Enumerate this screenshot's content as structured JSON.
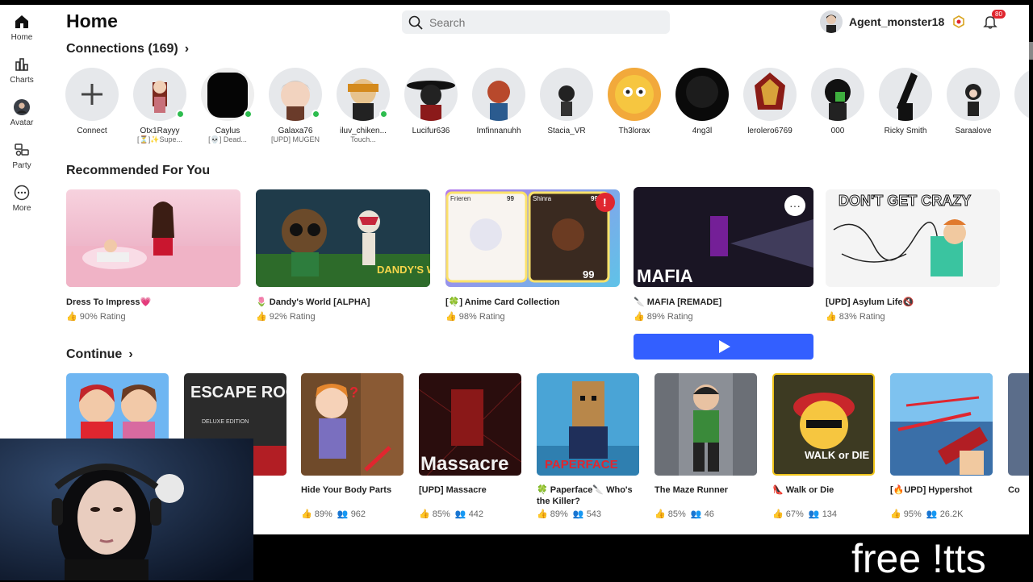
{
  "sidebar": {
    "items": [
      {
        "label": "Home",
        "icon": "home-icon"
      },
      {
        "label": "Charts",
        "icon": "charts-icon"
      },
      {
        "label": "Avatar",
        "icon": "avatar-icon"
      },
      {
        "label": "Party",
        "icon": "party-icon"
      },
      {
        "label": "More",
        "icon": "more-icon"
      }
    ]
  },
  "header": {
    "title": "Home",
    "search_placeholder": "Search",
    "username": "Agent_monster18",
    "notification_count": "80"
  },
  "connections": {
    "title": "Connections (169)",
    "items": [
      {
        "name": "Connect",
        "status": "",
        "online": false
      },
      {
        "name": "Otx1Rayyy",
        "status": "[⏳]✨Supe...",
        "online": true
      },
      {
        "name": "Caylus",
        "status": "[💀] Dead...",
        "online": true
      },
      {
        "name": "Galaxa76",
        "status": "[UPD] MUGEN",
        "online": true
      },
      {
        "name": "iluv_chiken...",
        "status": "Touch...",
        "online": true
      },
      {
        "name": "Lucifur636",
        "status": "",
        "online": false
      },
      {
        "name": "Imfinnanuhh",
        "status": "",
        "online": false
      },
      {
        "name": "Stacia_VR",
        "status": "",
        "online": false
      },
      {
        "name": "Th3lorax",
        "status": "",
        "online": false
      },
      {
        "name": "4ng3l",
        "status": "",
        "online": false
      },
      {
        "name": "lerolero6769",
        "status": "",
        "online": false
      },
      {
        "name": "000",
        "status": "",
        "online": false
      },
      {
        "name": "Ricky Smith",
        "status": "",
        "online": false
      },
      {
        "name": "Saraalove",
        "status": "",
        "online": false
      }
    ]
  },
  "recommended": {
    "title": "Recommended For You",
    "items": [
      {
        "title": "Dress To Impress💗",
        "rating": "90% Rating",
        "bg": "#f2c4d4"
      },
      {
        "title": "🌷 Dandy's World [ALPHA]",
        "rating": "92% Rating",
        "bg": "#1f3b4a",
        "logo": "DANDY'S WORLD"
      },
      {
        "title": "[🍀] Anime Card Collection",
        "rating": "98% Rating",
        "bg": "#9c6ad8",
        "card_labels": [
          "Frieren",
          "Shinra"
        ],
        "card_badges": [
          "99",
          "99",
          "99"
        ]
      },
      {
        "title": "🔪 MAFIA [REMADE]",
        "rating": "89% Rating",
        "bg": "#1a1524",
        "logo": "MAFIA"
      },
      {
        "title": "[UPD] Asylum Life🔇",
        "rating": "83% Rating",
        "bg": "#f4f4f4",
        "logo": "DON'T GET CRAZY"
      }
    ]
  },
  "continue_section": {
    "title": "Continue",
    "items": [
      {
        "title": "",
        "rating": "",
        "players": "",
        "bg": "#6fb6f2"
      },
      {
        "title": "-",
        "rating": "",
        "players": "",
        "bg": "#2b2b2b",
        "logo": "ESCAPE ROOM",
        "sub": "DELUXE EDITION"
      },
      {
        "title": "Hide Your Body Parts",
        "rating": "89%",
        "players": "962",
        "bg": "#f0a25a"
      },
      {
        "title": "[UPD] Massacre",
        "rating": "85%",
        "players": "442",
        "bg": "#2a0d0d",
        "logo": "Massacre"
      },
      {
        "title": "🍀 Paperface🔪 Who's the Killer?",
        "rating": "89%",
        "players": "543",
        "bg": "#4aa4d6",
        "logo": "PAPERFACE"
      },
      {
        "title": "The Maze Runner",
        "rating": "85%",
        "players": "46",
        "bg": "#8b8f96"
      },
      {
        "title": "👠 Walk or Die",
        "rating": "67%",
        "players": "134",
        "bg": "#3d3a22",
        "logo": "WALK or DIE"
      },
      {
        "title": "[🔥UPD] Hypershot",
        "rating": "95%",
        "players": "26.2K",
        "bg": "#3e8fd6"
      },
      {
        "title": "Co",
        "rating": "",
        "players": "",
        "bg": "#5b6d8a"
      }
    ]
  },
  "stream_overlay": {
    "text": "free !tts"
  }
}
